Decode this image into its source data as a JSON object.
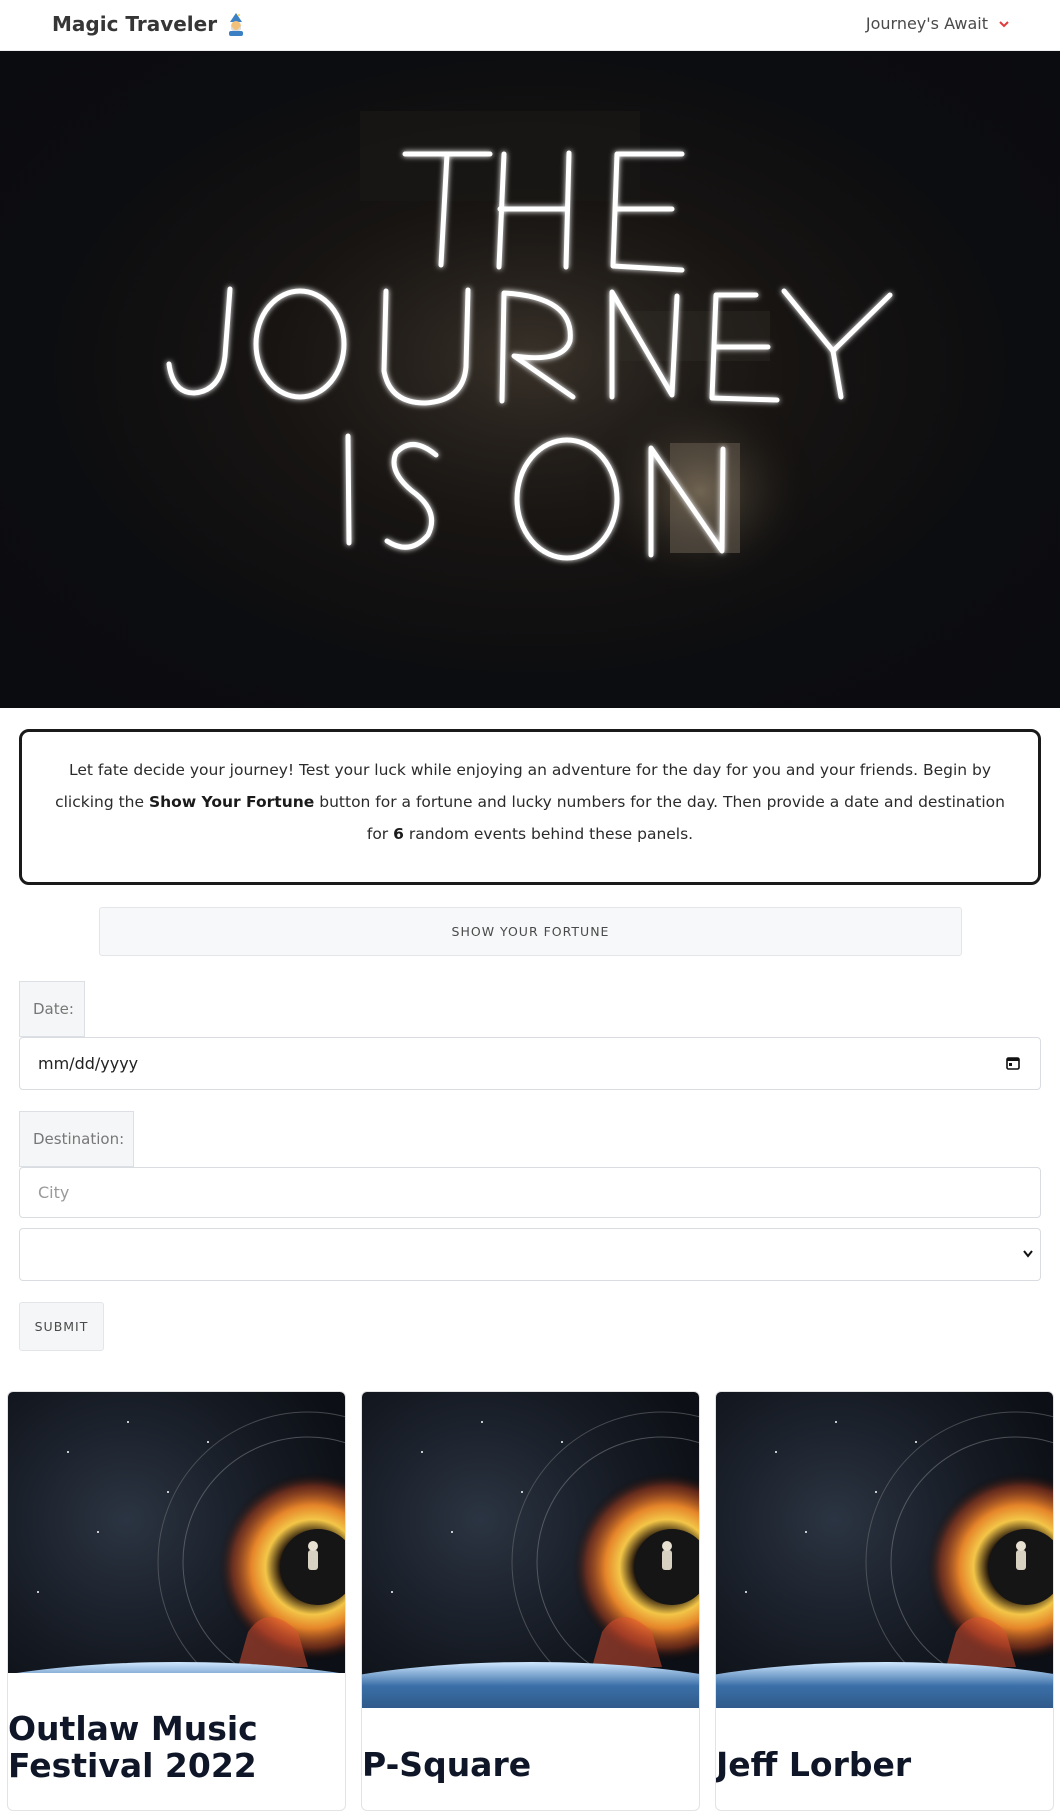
{
  "navbar": {
    "brand": "Magic Traveler",
    "brand_icon": "wizard-emoji-icon",
    "dropdown_label": "Journey's Await",
    "dropdown_icon": "chevron-down-icon",
    "accent_color": "#e03c3c"
  },
  "hero": {
    "neon_lines": [
      "THE",
      "JOURNEY",
      "IS ON"
    ]
  },
  "intro": {
    "text_1": "Let fate decide your journey! Test your luck while enjoying an adventure for the day for you and your friends. Begin by clicking the",
    "bold_1": "Show Your Fortune",
    "text_2": "button for a fortune and lucky numbers for the day. Then provide a date and destination for",
    "bold_2": "6",
    "text_3": "random events behind these panels."
  },
  "fortune_button": "SHOW YOUR FORTUNE",
  "form": {
    "date_label": "Date:",
    "date_placeholder": "mm/dd/yyyy",
    "destination_label": "Destination:",
    "city_placeholder": "City",
    "select_value": "",
    "submit_label": "SUBMIT"
  },
  "cards": [
    {
      "title": "Outlaw Music Festival 2022",
      "image": "black-hole-astronaut-image"
    },
    {
      "title": "P-Square",
      "image": "black-hole-astronaut-image"
    },
    {
      "title": "Jeff Lorber",
      "image": "black-hole-astronaut-image"
    }
  ]
}
